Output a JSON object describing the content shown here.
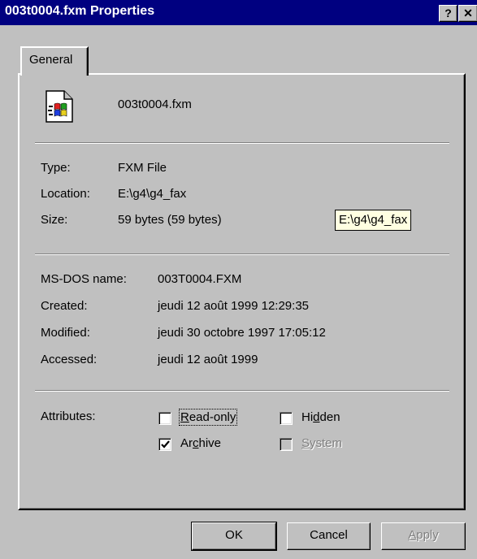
{
  "window": {
    "title": "003t0004.fxm Properties",
    "help_label": "?",
    "close_label": "✕"
  },
  "tabs": [
    {
      "label": "General",
      "selected": true
    }
  ],
  "file": {
    "name": "003t0004.fxm",
    "icon": "fax-document-icon"
  },
  "info": {
    "type_label": "Type:",
    "type_value": "FXM File",
    "location_label": "Location:",
    "location_value": "E:\\g4\\g4_fax",
    "size_label": "Size:",
    "size_value": "59 bytes (59 bytes)",
    "tooltip": "E:\\g4\\g4_fax"
  },
  "dates": {
    "msdos_label": "MS-DOS name:",
    "msdos_value": "003T0004.FXM",
    "created_label": "Created:",
    "created_value": "jeudi 12 août 1999 12:29:35",
    "modified_label": "Modified:",
    "modified_value": "jeudi 30 octobre 1997 17:05:12",
    "accessed_label": "Accessed:",
    "accessed_value": "jeudi 12 août 1999"
  },
  "attributes": {
    "label": "Attributes:",
    "readonly": {
      "prefix": "",
      "accel": "R",
      "rest": "ead-only",
      "checked": false,
      "enabled": true
    },
    "hidden": {
      "prefix": "Hi",
      "accel": "d",
      "rest": "den",
      "checked": false,
      "enabled": true
    },
    "archive": {
      "prefix": "Ar",
      "accel": "c",
      "rest": "hive",
      "checked": true,
      "enabled": true
    },
    "system": {
      "prefix": "",
      "accel": "S",
      "rest": "ystem",
      "checked": false,
      "enabled": false
    }
  },
  "buttons": {
    "ok": "OK",
    "cancel": "Cancel",
    "apply_accel": "A",
    "apply_rest": "pply"
  }
}
